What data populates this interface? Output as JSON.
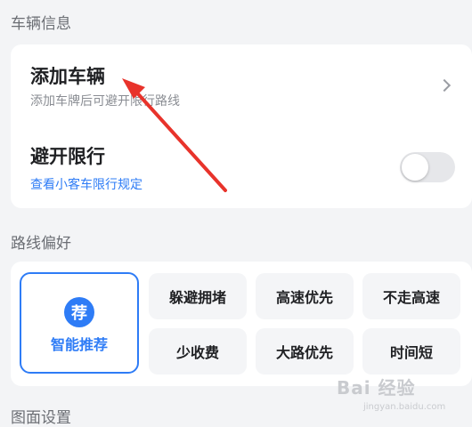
{
  "vehicle_section": {
    "title": "车辆信息",
    "add_vehicle": {
      "title": "添加车辆",
      "subtitle": "添加车牌后可避开限行路线"
    },
    "avoid_restriction": {
      "title": "避开限行",
      "link": "查看小客车限行规定",
      "toggle_on": false
    }
  },
  "route_section": {
    "title": "路线偏好",
    "recommended": {
      "badge": "荐",
      "label": "智能推荐",
      "selected": true
    },
    "options": [
      "躲避拥堵",
      "高速优先",
      "不走高速",
      "少收费",
      "大路优先",
      "时间短"
    ]
  },
  "map_section": {
    "title": "图面设置"
  },
  "watermark": {
    "text": "Bai 经验",
    "sub": "jingyan.baidu.com"
  },
  "colors": {
    "accent": "#2e7cf6",
    "annotation_arrow": "#e8332b",
    "background": "#f3f4f6"
  }
}
